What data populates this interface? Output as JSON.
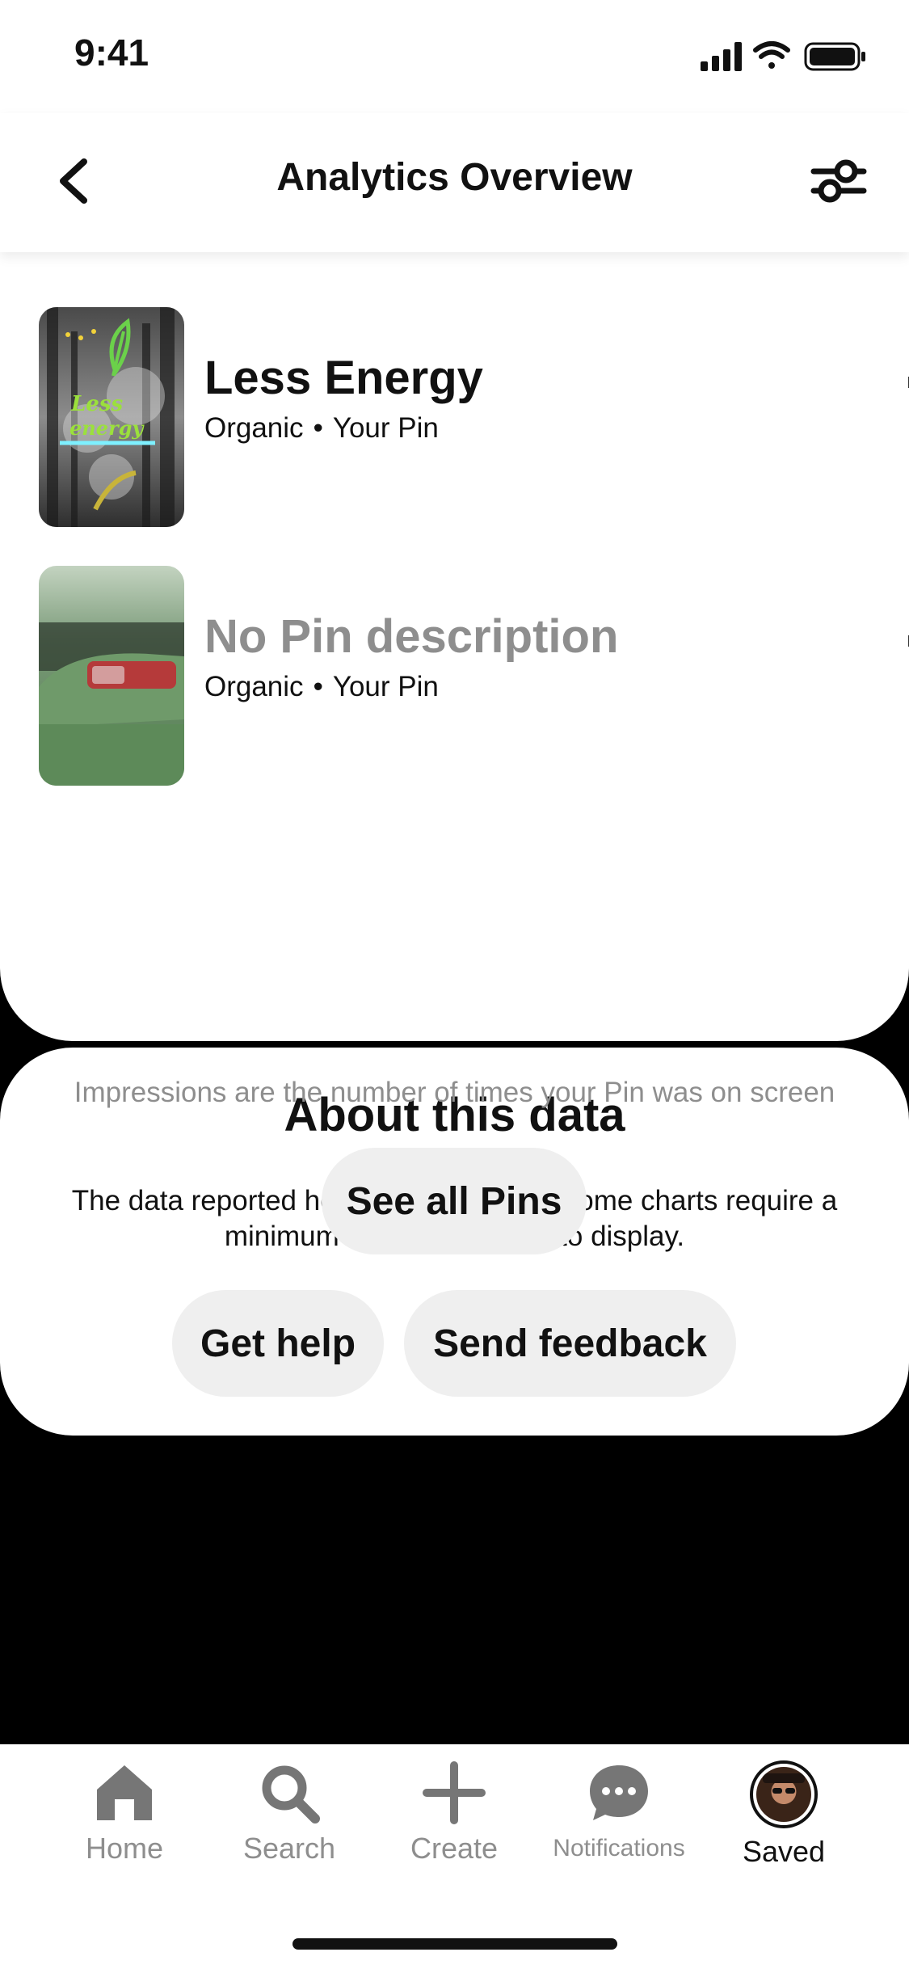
{
  "status_bar": {
    "time": "9:41"
  },
  "header": {
    "title": "Analytics Overview"
  },
  "pins": [
    {
      "title": "Less Energy",
      "source": "Organic",
      "owner": "Your Pin",
      "title_muted": false
    },
    {
      "title": "No Pin description",
      "source": "Organic",
      "owner": "Your Pin",
      "title_muted": true
    }
  ],
  "impressions_note": "Impressions are the number of times your Pin was on screen",
  "see_all_label": "See all Pins",
  "about": {
    "title": "About this data",
    "text": "The data reported here is an estimate. Some charts require a minimum number of users to display.",
    "help_label": "Get help",
    "feedback_label": "Send feedback"
  },
  "tab_bar": {
    "items": [
      {
        "label": "Home",
        "icon": "home-icon",
        "active": false
      },
      {
        "label": "Search",
        "icon": "search-icon",
        "active": false
      },
      {
        "label": "Create",
        "icon": "plus-icon",
        "active": false
      },
      {
        "label": "Notifications",
        "icon": "chat-bubble-icon",
        "active": false
      },
      {
        "label": "Saved",
        "icon": "avatar",
        "active": true
      }
    ]
  },
  "colors": {
    "muted_text": "#8e8e8e",
    "pill_bg": "#efefef",
    "icon_gray": "#767676"
  }
}
